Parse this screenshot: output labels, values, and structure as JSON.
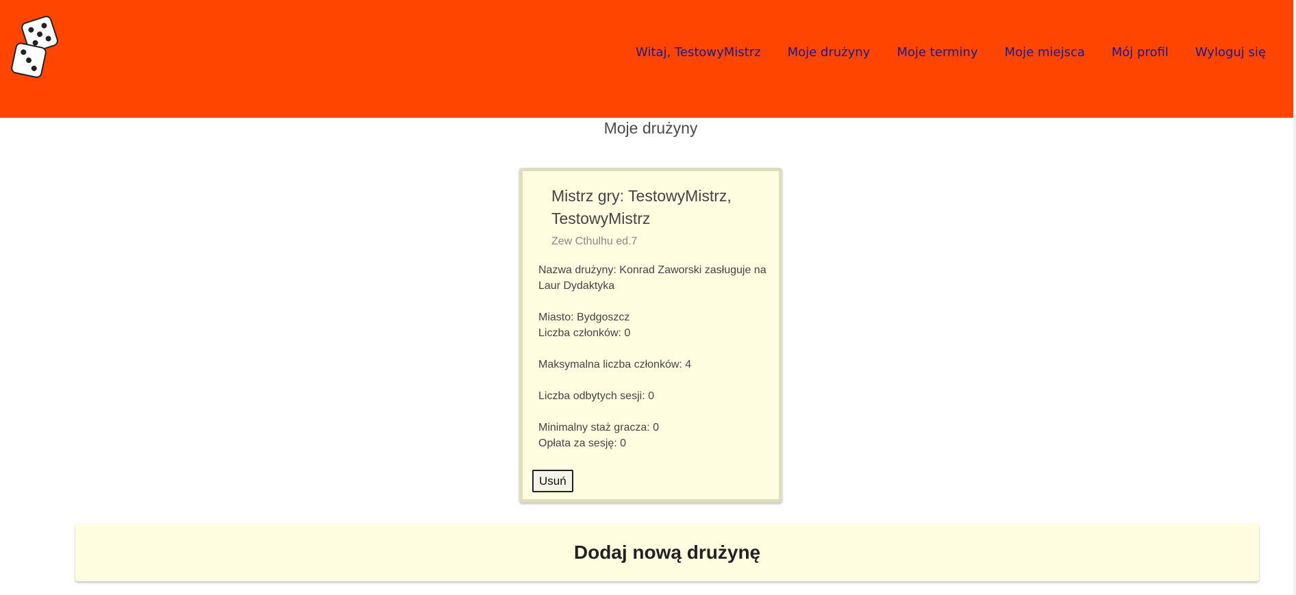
{
  "nav": {
    "welcome": "Witaj, TestowyMistrz",
    "teams": "Moje drużyny",
    "dates": "Moje terminy",
    "places": "Moje miejsca",
    "profile": "Mój profil",
    "logout": "Wyloguj się"
  },
  "page": {
    "title": "Moje drużyny"
  },
  "card": {
    "title": "Mistrz gry: TestowyMistrz, TestowyMistrz",
    "subtitle": "Zew Cthulhu ed.7",
    "team_name": "Nazwa drużyny: Konrad Zaworski zasługuje na Laur Dydaktyka",
    "city": "Miasto: Bydgoszcz",
    "members": "Liczba członków: 0",
    "max_members": "Maksymalna liczba członków: 4",
    "sessions": "Liczba odbytych sesji: 0",
    "min_experience": "Minimalny staż gracza: 0",
    "fee": "Opłata za sesję: 0",
    "delete_label": "Usuń"
  },
  "add_team": {
    "label": "Dodaj nową drużynę"
  },
  "colors": {
    "header": "#ff4500",
    "nav_link": "#1a1a8c",
    "card_bg": "#fffde0",
    "card_border": "#deddc0"
  },
  "icons": {
    "logo": "dice-logo-icon"
  }
}
